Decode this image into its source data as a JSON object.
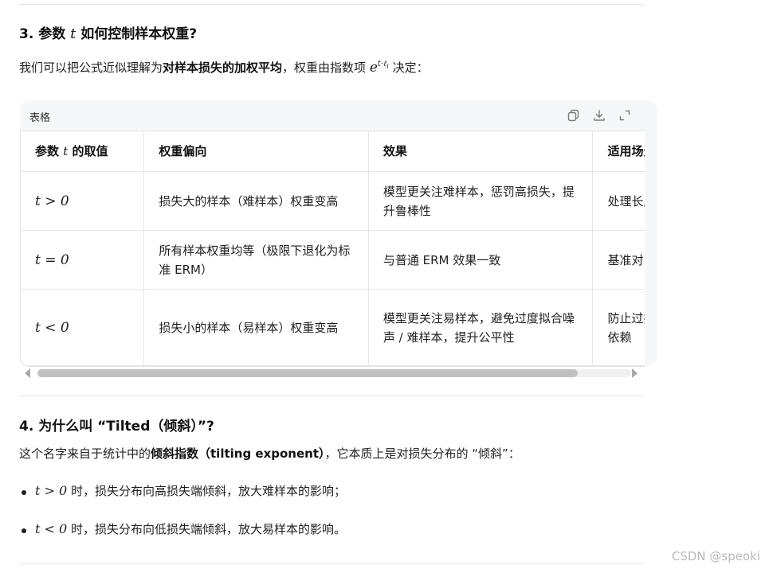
{
  "section3": {
    "heading_prefix": "3. 参数 ",
    "heading_var": "t",
    "heading_suffix": " 如何控制样本权重?",
    "para_before": "我们可以把公式近似理解为",
    "para_bold": "对样本损失的加权平均",
    "para_middle": "，权重由指数项 ",
    "exp_base": "e",
    "exp_power": "t·ℓ",
    "exp_sub": "i",
    "para_after": " 决定："
  },
  "table_card": {
    "title": "表格",
    "tools": [
      "copy-icon",
      "download-icon",
      "expand-icon"
    ],
    "headers": [
      {
        "prefix": "参数 ",
        "var": "t",
        "suffix": " 的取值"
      },
      {
        "label": "权重偏向"
      },
      {
        "label": "效果"
      },
      {
        "label": "适用场景"
      }
    ],
    "rows": [
      {
        "cond": "t > 0",
        "weight": "损失大的样本（难样本）权重变高",
        "effect": "模型更关注难样本，惩罚高损失，提升鲁棒性",
        "scenario": "处理长尾数据、对抗样本、分布偏移"
      },
      {
        "cond": "t = 0",
        "weight": "所有样本权重均等（极限下退化为标准 ERM）",
        "effect": "与普通 ERM 效果一致",
        "scenario": "基准对比"
      },
      {
        "cond": "t < 0",
        "weight": "损失小的样本（易样本）权重变高",
        "effect": "模型更关注易样本，避免过度拟合噪声 / 难样本，提升公平性",
        "scenario": "防止过拟合、减少对少数极端样本的依赖"
      }
    ],
    "scrollbar_position": 0.0
  },
  "section4": {
    "heading": "4. 为什么叫 “Tilted（倾斜）”?",
    "para_before": "这个名字来自于统计中的",
    "para_bold": "倾斜指数（tilting exponent）",
    "para_after": "，它本质上是对损失分布的 “倾斜”：",
    "bullets": [
      {
        "cond": "t > 0",
        "text": " 时，损失分布向高损失端倾斜，放大难样本的影响；"
      },
      {
        "cond": "t < 0",
        "text": " 时，损失分布向低损失端倾斜，放大易样本的影响。"
      }
    ]
  },
  "watermark": "CSDN @speoki"
}
